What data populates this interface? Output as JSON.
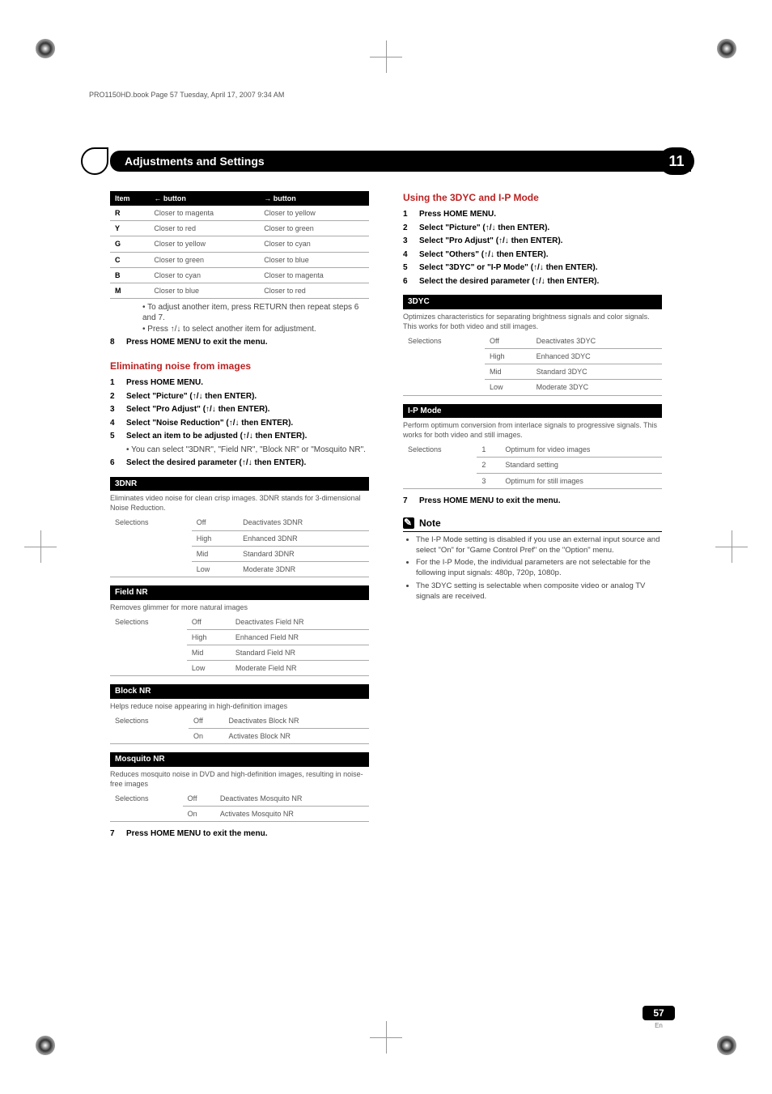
{
  "book_note": "PRO1150HD.book  Page 57  Tuesday, April 17, 2007  9:34 AM",
  "banner_title": "Adjustments and Settings",
  "banner_number": "11",
  "left": {
    "table1": {
      "headers": [
        "Item",
        "← button",
        "→ button"
      ],
      "rows": [
        [
          "R",
          "Closer to magenta",
          "Closer to yellow"
        ],
        [
          "Y",
          "Closer to red",
          "Closer to green"
        ],
        [
          "G",
          "Closer to yellow",
          "Closer to cyan"
        ],
        [
          "C",
          "Closer to green",
          "Closer to blue"
        ],
        [
          "B",
          "Closer to cyan",
          "Closer to magenta"
        ],
        [
          "M",
          "Closer to blue",
          "Closer to red"
        ]
      ]
    },
    "sub_bullets": [
      "To adjust another item, press RETURN then repeat steps 6 and 7.",
      "Press ↑/↓ to select another item for adjustment."
    ],
    "step8": "Press HOME MENU to exit the menu.",
    "elim_heading": "Eliminating noise from images",
    "steps": [
      "Press HOME MENU.",
      "Select \"Picture\" (↑/↓ then ENTER).",
      "Select \"Pro Adjust\" (↑/↓ then ENTER).",
      "Select \"Noise Reduction\" (↑/↓ then ENTER).",
      "Select an item to be adjusted (↑/↓ then ENTER).",
      "Select the desired parameter (↑/↓ then ENTER)."
    ],
    "step5_sub": "You can select \"3DNR\", \"Field NR\", \"Block NR\" or \"Mosquito NR\".",
    "dnr": {
      "title": "3DNR",
      "desc": "Eliminates video noise for clean crisp images. 3DNR stands for 3-dimensional Noise Reduction.",
      "sel": "Selections",
      "rows": [
        [
          "Off",
          "Deactivates 3DNR"
        ],
        [
          "High",
          "Enhanced 3DNR"
        ],
        [
          "Mid",
          "Standard 3DNR"
        ],
        [
          "Low",
          "Moderate 3DNR"
        ]
      ]
    },
    "fieldnr": {
      "title": "Field NR",
      "desc": "Removes glimmer for more natural images",
      "rows": [
        [
          "Off",
          "Deactivates Field NR"
        ],
        [
          "High",
          "Enhanced Field NR"
        ],
        [
          "Mid",
          "Standard Field NR"
        ],
        [
          "Low",
          "Moderate Field NR"
        ]
      ]
    },
    "blocknr": {
      "title": "Block NR",
      "desc": "Helps reduce noise appearing in high-definition images",
      "rows": [
        [
          "Off",
          "Deactivates Block NR"
        ],
        [
          "On",
          "Activates Block NR"
        ]
      ]
    },
    "mosq": {
      "title": "Mosquito NR",
      "desc": "Reduces mosquito noise in DVD and high-definition images, resulting in noise-free images",
      "rows": [
        [
          "Off",
          "Deactivates Mosquito NR"
        ],
        [
          "On",
          "Activates Mosquito NR"
        ]
      ]
    },
    "step7_exit": "Press HOME MENU to exit the menu."
  },
  "right": {
    "heading": "Using the 3DYC and I-P Mode",
    "steps": [
      "Press HOME MENU.",
      "Select \"Picture\" (↑/↓ then ENTER).",
      "Select \"Pro Adjust\" (↑/↓ then ENTER).",
      "Select \"Others\" (↑/↓ then ENTER).",
      "Select \"3DYC\" or \"I-P Mode\" (↑/↓ then ENTER).",
      "Select the desired parameter (↑/↓ then ENTER)."
    ],
    "d3yc": {
      "title": "3DYC",
      "desc": "Optimizes characteristics for separating brightness signals and color signals. This works for both video and still images.",
      "rows": [
        [
          "Off",
          "Deactivates 3DYC"
        ],
        [
          "High",
          "Enhanced 3DYC"
        ],
        [
          "Mid",
          "Standard 3DYC"
        ],
        [
          "Low",
          "Moderate 3DYC"
        ]
      ]
    },
    "ipmode": {
      "title": "I-P Mode",
      "desc": "Perform optimum conversion from interlace signals to progressive signals. This works for both video and still images.",
      "rows": [
        [
          "1",
          "Optimum for video images"
        ],
        [
          "2",
          "Standard setting"
        ],
        [
          "3",
          "Optimum for still images"
        ]
      ]
    },
    "step7_exit": "Press HOME MENU to exit the menu.",
    "note_label": "Note",
    "notes": [
      "The I-P Mode setting is disabled if you use an external input source and select \"On\" for \"Game Control Pref\" on the \"Option\" menu.",
      "For the I-P Mode, the individual parameters are not selectable for the following input signals: 480p, 720p, 1080p.",
      "The 3DYC setting is selectable when composite video or analog TV signals are received."
    ]
  },
  "pagefoot": {
    "num": "57",
    "lang": "En"
  },
  "sel_label": "Selections"
}
